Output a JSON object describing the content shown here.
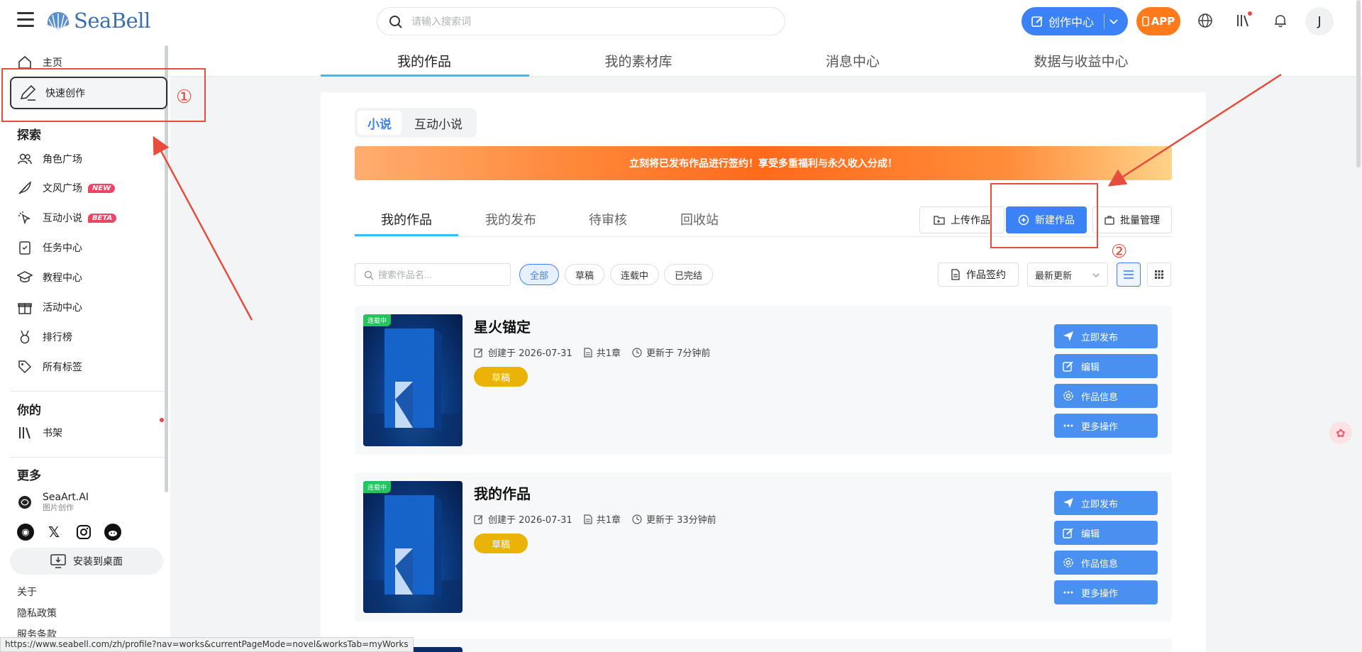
{
  "header": {
    "logo_text": "SeaBell",
    "search_placeholder": "请输入搜索词",
    "create_center_label": "创作中心",
    "app_label": "APP",
    "avatar_initial": "J"
  },
  "sidebar": {
    "home": "主页",
    "quick_create": "快速创作",
    "explore_heading": "探索",
    "items": [
      {
        "label": "角色广场"
      },
      {
        "label": "文风广场",
        "badge": "NEW"
      },
      {
        "label": "互动小说",
        "badge": "BETA"
      },
      {
        "label": "任务中心"
      },
      {
        "label": "教程中心"
      },
      {
        "label": "活动中心"
      },
      {
        "label": "排行榜"
      },
      {
        "label": "所有标签"
      }
    ],
    "yours_heading": "你的",
    "bookshelf": "书架",
    "more_heading": "更多",
    "seaart_name": "SeaArt.AI",
    "seaart_sub": "图片创作",
    "install_label": "安装到桌面",
    "links": [
      "关于",
      "隐私政策",
      "服务条款"
    ]
  },
  "main_tabs": [
    "我的作品",
    "我的素材库",
    "消息中心",
    "数据与收益中心"
  ],
  "segment": [
    "小说",
    "互动小说"
  ],
  "banner_text": "立刻将已发布作品进行签约！享受多重福利与永久收入分成！",
  "sub_tabs": [
    "我的作品",
    "我的发布",
    "待审核",
    "回收站"
  ],
  "actions": {
    "upload": "上传作品",
    "new_work": "新建作品",
    "batch": "批量管理",
    "search_placeholder": "搜索作品名...",
    "sign": "作品签约",
    "sort": "最新更新"
  },
  "filters": [
    "全部",
    "草稿",
    "连载中",
    "已完结"
  ],
  "works": [
    {
      "status": "连载中",
      "title": "星火锚定",
      "created": "创建于 2026-07-31",
      "chapters": "共1章",
      "updated": "更新于 7分钟前",
      "tag": "草稿"
    },
    {
      "status": "连载中",
      "title": "我的作品",
      "created": "创建于 2026-07-31",
      "chapters": "共1章",
      "updated": "更新于 33分钟前",
      "tag": "草稿"
    }
  ],
  "work_actions": [
    "立即发布",
    "编辑",
    "作品信息",
    "更多操作"
  ],
  "annotations": {
    "step1": "①",
    "step2": "②"
  },
  "status_url": "https://www.seabell.com/zh/profile?nav=works&currentPageMode=novel&worksTab=myWorks",
  "colors": {
    "accent": "#3b82f6",
    "annotation": "#e74c3c",
    "draft": "#eab308",
    "status": "#22c55e"
  }
}
